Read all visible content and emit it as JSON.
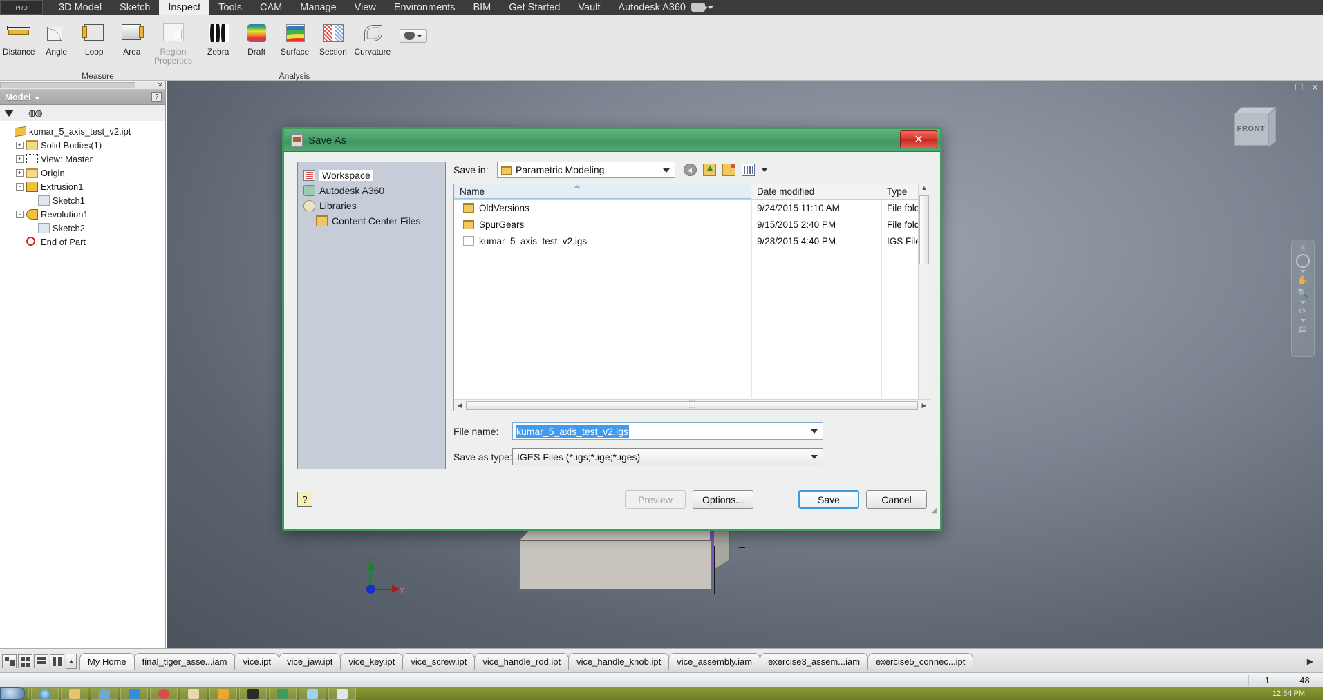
{
  "ribbon": {
    "pro_badge": "PRO",
    "tabs": [
      {
        "label": "3D Model",
        "active": false
      },
      {
        "label": "Sketch",
        "active": false
      },
      {
        "label": "Inspect",
        "active": true
      },
      {
        "label": "Tools",
        "active": false
      },
      {
        "label": "CAM",
        "active": false
      },
      {
        "label": "Manage",
        "active": false
      },
      {
        "label": "View",
        "active": false
      },
      {
        "label": "Environments",
        "active": false
      },
      {
        "label": "BIM",
        "active": false
      },
      {
        "label": "Get Started",
        "active": false
      },
      {
        "label": "Vault",
        "active": false
      },
      {
        "label": "Autodesk A360",
        "active": false
      }
    ],
    "panels": [
      {
        "title": "Measure",
        "buttons": [
          {
            "label": "Distance",
            "icon": "distance-icon",
            "disabled": false
          },
          {
            "label": "Angle",
            "icon": "angle-icon",
            "disabled": false
          },
          {
            "label": "Loop",
            "icon": "loop-icon",
            "disabled": false
          },
          {
            "label": "Area",
            "icon": "area-icon",
            "disabled": false
          },
          {
            "label": "Region Properties",
            "icon": "region-properties-icon",
            "disabled": true
          }
        ]
      },
      {
        "title": "Analysis",
        "buttons": [
          {
            "label": "Zebra",
            "icon": "zebra-icon",
            "disabled": false
          },
          {
            "label": "Draft",
            "icon": "draft-icon",
            "disabled": false
          },
          {
            "label": "Surface",
            "icon": "surface-icon",
            "disabled": false
          },
          {
            "label": "Section",
            "icon": "section-icon",
            "disabled": false
          },
          {
            "label": "Curvature",
            "icon": "curvature-icon",
            "disabled": false
          }
        ]
      }
    ]
  },
  "browser": {
    "title": "Model",
    "help_label": "?",
    "tree": [
      {
        "label": "kumar_5_axis_test_v2.ipt",
        "icon": "part-icon",
        "indent": 0,
        "expander": ""
      },
      {
        "label": "Solid Bodies(1)",
        "icon": "solid-bodies-icon",
        "indent": 1,
        "expander": "+"
      },
      {
        "label": "View: Master",
        "icon": "view-icon",
        "indent": 1,
        "expander": "+"
      },
      {
        "label": "Origin",
        "icon": "folder-icon",
        "indent": 1,
        "expander": "+"
      },
      {
        "label": "Extrusion1",
        "icon": "extrusion-icon",
        "indent": 1,
        "expander": "-"
      },
      {
        "label": "Sketch1",
        "icon": "sketch-icon",
        "indent": 2,
        "expander": ""
      },
      {
        "label": "Revolution1",
        "icon": "revolution-icon",
        "indent": 1,
        "expander": "-"
      },
      {
        "label": "Sketch2",
        "icon": "sketch-icon",
        "indent": 2,
        "expander": ""
      },
      {
        "label": "End of Part",
        "icon": "end-of-part-icon",
        "indent": 1,
        "expander": ""
      }
    ]
  },
  "viewport": {
    "viewcube_face": "FRONT",
    "axis_x_label": "X",
    "axis_y_label": "Y",
    "window_minimize": "—",
    "window_restore": "❐",
    "window_close": "✕"
  },
  "dialog": {
    "title": "Save As",
    "close_label": "✕",
    "places": [
      {
        "label": "Workspace",
        "icon": "workspace-icon",
        "selected": true,
        "indent": 0
      },
      {
        "label": "Autodesk A360",
        "icon": "a360-icon",
        "selected": false,
        "indent": 0
      },
      {
        "label": "Libraries",
        "icon": "libraries-icon",
        "selected": false,
        "indent": 0
      },
      {
        "label": "Content Center Files",
        "icon": "content-center-folder-icon",
        "selected": false,
        "indent": 1
      }
    ],
    "save_in_label": "Save in:",
    "save_in_value": "Parametric Modeling",
    "nav_icons": [
      "back-icon",
      "up-one-level-icon",
      "create-new-folder-icon",
      "views-icon",
      "chevron-down-icon"
    ],
    "columns": [
      "Name",
      "Date modified",
      "Type"
    ],
    "files": [
      {
        "name": "OldVersions",
        "date": "9/24/2015 11:10 AM",
        "type": "File folder",
        "icon": "folder-icon"
      },
      {
        "name": "SpurGears",
        "date": "9/15/2015 2:40 PM",
        "type": "File folder",
        "icon": "folder-icon"
      },
      {
        "name": "kumar_5_axis_test_v2.igs",
        "date": "9/28/2015 4:40 PM",
        "type": "IGS File",
        "icon": "file-icon"
      }
    ],
    "file_name_label": "File name:",
    "file_name_value": "kumar_5_axis_test_v2.igs",
    "save_as_type_label": "Save as type:",
    "save_as_type_value": "IGES Files (*.igs;*.ige;*.iges)",
    "help_label": "?",
    "buttons": {
      "preview": "Preview",
      "options": "Options...",
      "save": "Save",
      "cancel": "Cancel"
    }
  },
  "doctabs": {
    "view_modes": [
      "tile-icon",
      "grid-icon",
      "rows-icon",
      "columns-icon"
    ],
    "scroll_up": "▲",
    "scroll_right": "▶",
    "tabs": [
      {
        "label": "My Home",
        "active": true
      },
      {
        "label": "final_tiger_asse...iam",
        "active": false
      },
      {
        "label": "vice.ipt",
        "active": false
      },
      {
        "label": "vice_jaw.ipt",
        "active": false
      },
      {
        "label": "vice_key.ipt",
        "active": false
      },
      {
        "label": "vice_screw.ipt",
        "active": false
      },
      {
        "label": "vice_handle_rod.ipt",
        "active": false
      },
      {
        "label": "vice_handle_knob.ipt",
        "active": false
      },
      {
        "label": "vice_assembly.iam",
        "active": false
      },
      {
        "label": "exercise3_assem...iam",
        "active": false
      },
      {
        "label": "exercise5_connec...ipt",
        "active": false
      }
    ]
  },
  "statusbar": {
    "cells": [
      "1",
      "48"
    ]
  },
  "taskbar": {
    "clock": "12:54 PM"
  },
  "colors": {
    "dialog_border": "#3f9a5e",
    "accent_blue": "#3e9bf0",
    "ribbon_dark": "#3b3b3b",
    "taskbar_green": "#8a9b34"
  }
}
